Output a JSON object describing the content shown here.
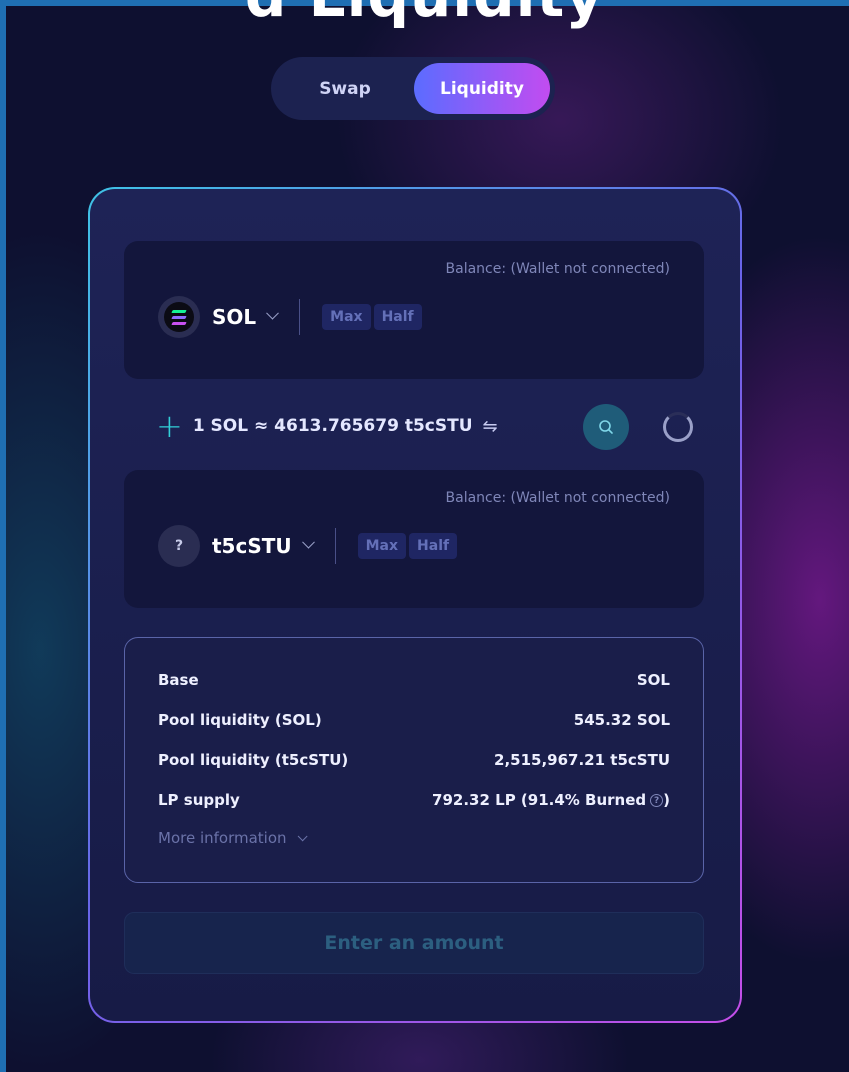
{
  "header": {
    "title_fragment": "d Liquidity"
  },
  "mode_toggle": {
    "swap_label": "Swap",
    "liquidity_label": "Liquidity",
    "active": "Liquidity"
  },
  "token_a": {
    "balance_label": "Balance: (Wallet not connected)",
    "symbol": "SOL",
    "icon": "solana-logo-icon",
    "max_label": "Max",
    "half_label": "Half"
  },
  "rate": {
    "text": "1 SOL ≈ 4613.765679 t5cSTU",
    "swap_icon": "⇋"
  },
  "token_b": {
    "balance_label": "Balance: (Wallet not connected)",
    "symbol": "t5cSTU",
    "icon_glyph": "?",
    "max_label": "Max",
    "half_label": "Half"
  },
  "pool_info": {
    "rows": [
      {
        "label": "Base",
        "value": "SOL"
      },
      {
        "label": "Pool liquidity (SOL)",
        "value": "545.32 SOL"
      },
      {
        "label": "Pool liquidity (t5cSTU)",
        "value": "2,515,967.21 t5cSTU"
      },
      {
        "label": "LP supply",
        "value": "792.32 LP (91.4% Burned",
        "value_suffix": ")"
      }
    ],
    "help_glyph": "?",
    "more_info_label": "More information"
  },
  "cta": {
    "label": "Enter an amount"
  },
  "colors": {
    "accent_gradient_start": "#5b6cff",
    "accent_gradient_end": "#c24cf0",
    "teal": "#32d0d8",
    "solana_bars": [
      "#14f195",
      "#8f6bff",
      "#c850f0"
    ]
  }
}
